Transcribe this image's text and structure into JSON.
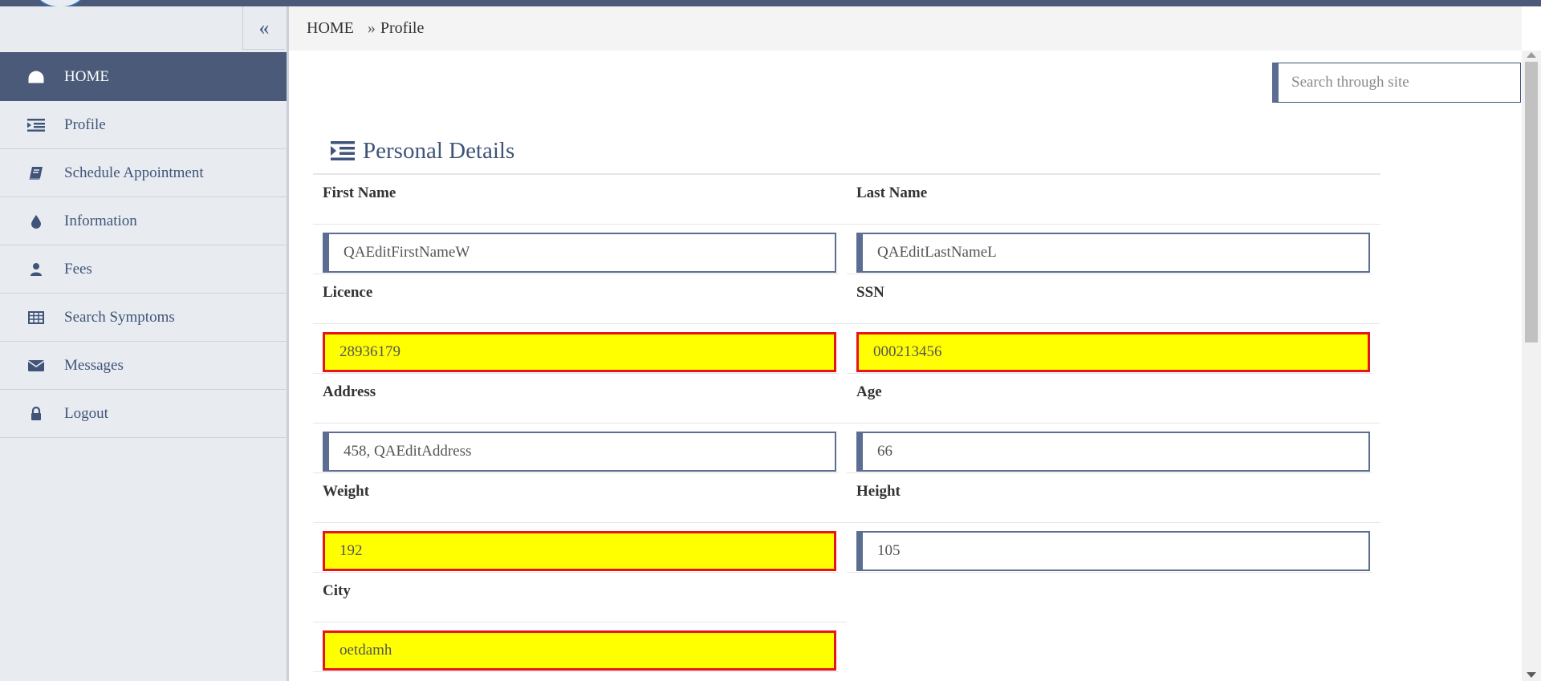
{
  "header": {
    "brand_color": "#4a5a78"
  },
  "sidebar": {
    "collapse_label": "«",
    "items": [
      {
        "label": "HOME",
        "icon": "dashboard-icon",
        "active": true
      },
      {
        "label": "Profile",
        "icon": "indent-list-icon"
      },
      {
        "label": "Schedule Appointment",
        "icon": "book-icon"
      },
      {
        "label": "Information",
        "icon": "droplet-icon"
      },
      {
        "label": "Fees",
        "icon": "user-icon"
      },
      {
        "label": "Search Symptoms",
        "icon": "table-icon"
      },
      {
        "label": "Messages",
        "icon": "envelope-icon"
      },
      {
        "label": "Logout",
        "icon": "lock-icon"
      }
    ]
  },
  "breadcrumb": {
    "home": "HOME",
    "separator": "»",
    "current": "Profile"
  },
  "search": {
    "placeholder": "Search through site"
  },
  "panel": {
    "title": "Personal Details",
    "fields": {
      "first_name": {
        "label": "First Name",
        "value": "QAEditFirstNameW",
        "error": false
      },
      "last_name": {
        "label": "Last Name",
        "value": "QAEditLastNameL",
        "error": false
      },
      "licence": {
        "label": "Licence",
        "value": "28936179",
        "error": true
      },
      "ssn": {
        "label": "SSN",
        "value": "000213456",
        "error": true
      },
      "address": {
        "label": "Address",
        "value": "458, QAEditAddress",
        "error": false
      },
      "age": {
        "label": "Age",
        "value": "66",
        "error": false
      },
      "weight": {
        "label": "Weight",
        "value": "192",
        "error": true
      },
      "height": {
        "label": "Height",
        "value": "105",
        "error": false
      },
      "city": {
        "label": "City",
        "value": "oetdamh",
        "error": true
      }
    }
  },
  "colors": {
    "accent": "#4a5a78",
    "error_border": "#e8141c",
    "error_fill": "#ffff00"
  }
}
